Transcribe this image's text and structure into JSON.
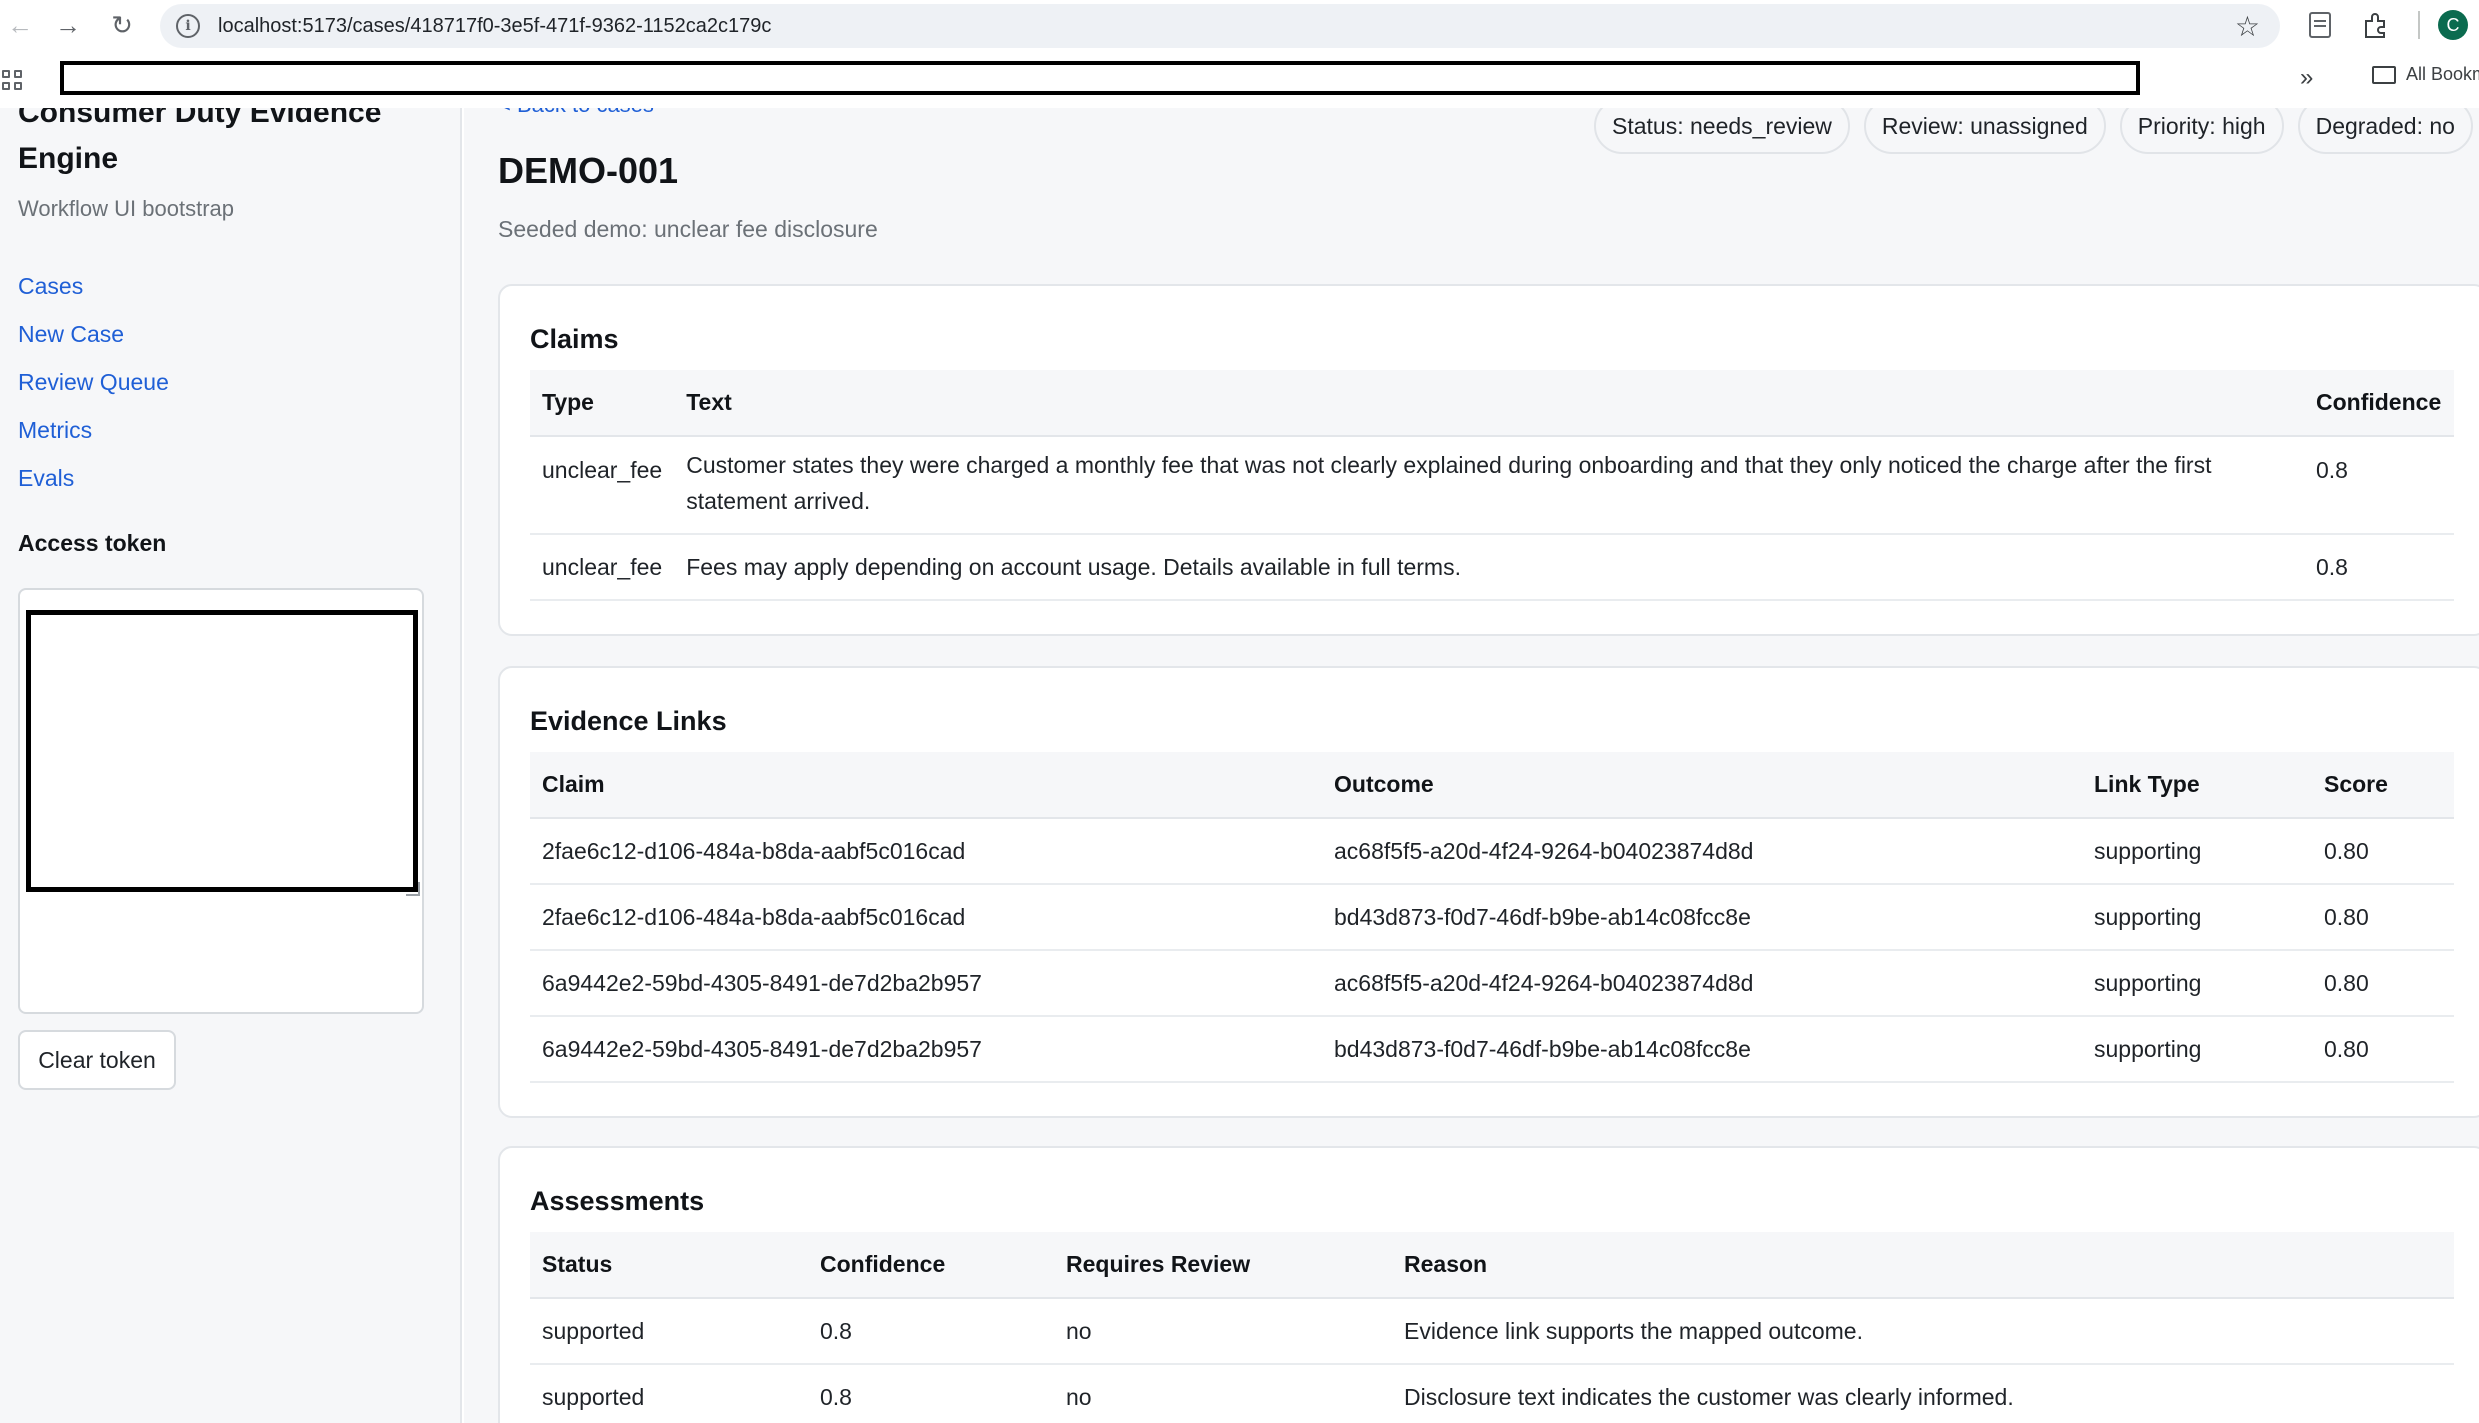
{
  "browser": {
    "url": "localhost:5173/cases/418717f0-3e5f-471f-9362-1152ca2c179c",
    "bookmarks_label": "All Bookm",
    "profile_initial": "C"
  },
  "sidebar": {
    "title": "Consumer Duty Evidence Engine",
    "subtitle": "Workflow UI bootstrap",
    "nav": [
      {
        "label": "Cases"
      },
      {
        "label": "New Case"
      },
      {
        "label": "Review Queue"
      },
      {
        "label": "Metrics"
      },
      {
        "label": "Evals"
      }
    ],
    "token_label": "Access token",
    "token_value": "",
    "clear_button": "Clear token"
  },
  "case": {
    "back_link": "< Back to cases",
    "title": "DEMO-001",
    "subtitle": "Seeded demo: unclear fee disclosure",
    "pills": {
      "status": "Status: needs_review",
      "review": "Review: unassigned",
      "priority": "Priority: high",
      "degraded": "Degraded: no"
    }
  },
  "claims": {
    "heading": "Claims",
    "columns": [
      "Type",
      "Text",
      "Confidence"
    ],
    "rows": [
      {
        "type": "unclear_fee",
        "text": "Customer states they were charged a monthly fee that was not clearly explained during onboarding and that they only noticed the charge after the first statement arrived.",
        "confidence": "0.8"
      },
      {
        "type": "unclear_fee",
        "text": "Fees may apply depending on account usage. Details available in full terms.",
        "confidence": "0.8"
      }
    ]
  },
  "evidence_links": {
    "heading": "Evidence Links",
    "columns": [
      "Claim",
      "Outcome",
      "Link Type",
      "Score"
    ],
    "rows": [
      {
        "claim": "2fae6c12-d106-484a-b8da-aabf5c016cad",
        "outcome": "ac68f5f5-a20d-4f24-9264-b04023874d8d",
        "link_type": "supporting",
        "score": "0.80"
      },
      {
        "claim": "2fae6c12-d106-484a-b8da-aabf5c016cad",
        "outcome": "bd43d873-f0d7-46df-b9be-ab14c08fcc8e",
        "link_type": "supporting",
        "score": "0.80"
      },
      {
        "claim": "6a9442e2-59bd-4305-8491-de7d2ba2b957",
        "outcome": "ac68f5f5-a20d-4f24-9264-b04023874d8d",
        "link_type": "supporting",
        "score": "0.80"
      },
      {
        "claim": "6a9442e2-59bd-4305-8491-de7d2ba2b957",
        "outcome": "bd43d873-f0d7-46df-b9be-ab14c08fcc8e",
        "link_type": "supporting",
        "score": "0.80"
      }
    ]
  },
  "assessments": {
    "heading": "Assessments",
    "columns": [
      "Status",
      "Confidence",
      "Requires Review",
      "Reason"
    ],
    "rows": [
      {
        "status": "supported",
        "confidence": "0.8",
        "requires_review": "no",
        "reason": "Evidence link supports the mapped outcome."
      },
      {
        "status": "supported",
        "confidence": "0.8",
        "requires_review": "no",
        "reason": "Disclosure text indicates the customer was clearly informed."
      }
    ]
  }
}
